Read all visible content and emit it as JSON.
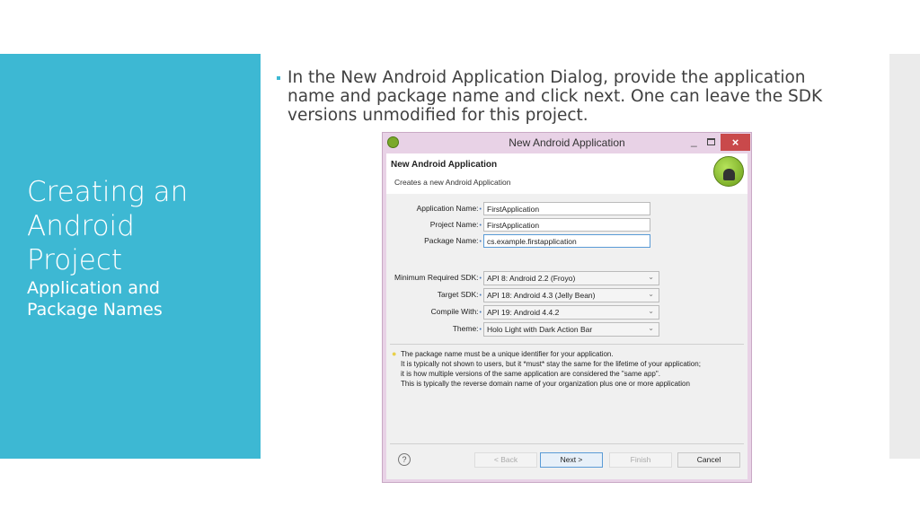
{
  "slide": {
    "title_lines": [
      "Creating an",
      "Android",
      "Project"
    ],
    "subtitle_lines": [
      "Application and",
      "Package Names"
    ],
    "bullet": "In the New Android Application Dialog, provide the application name and package name and click next. One can leave the SDK versions unmodified for this project."
  },
  "dialog": {
    "window_title": "New Android Application",
    "header_title": "New Android Application",
    "header_desc": "Creates a new Android Application",
    "fields": [
      {
        "label": "Application Name:",
        "value": "FirstApplication"
      },
      {
        "label": "Project Name:",
        "value": "FirstApplication"
      },
      {
        "label": "Package Name:",
        "value": "cs.example.firstapplication"
      }
    ],
    "selects": [
      {
        "label": "Minimum Required SDK:",
        "value": "API 8: Android 2.2 (Froyo)"
      },
      {
        "label": "Target SDK:",
        "value": "API 18: Android 4.3 (Jelly Bean)"
      },
      {
        "label": "Compile With:",
        "value": "API 19: Android 4.4.2"
      },
      {
        "label": "Theme:",
        "value": "Holo Light with Dark Action Bar"
      }
    ],
    "hint_lines": [
      "The package name must be a unique identifier for your application.",
      "It is typically not shown to users, but it *must* stay the same for the lifetime of your application;",
      "it is how multiple versions of the same application are considered the \"same app\".",
      "This is typically the reverse domain name of your organization plus one or more application"
    ],
    "buttons": {
      "help": "?",
      "back": "< Back",
      "next": "Next >",
      "finish": "Finish",
      "cancel": "Cancel"
    },
    "controls": {
      "minimize": "_",
      "close": "×"
    }
  },
  "colors": {
    "accent": "#3db8d3"
  }
}
